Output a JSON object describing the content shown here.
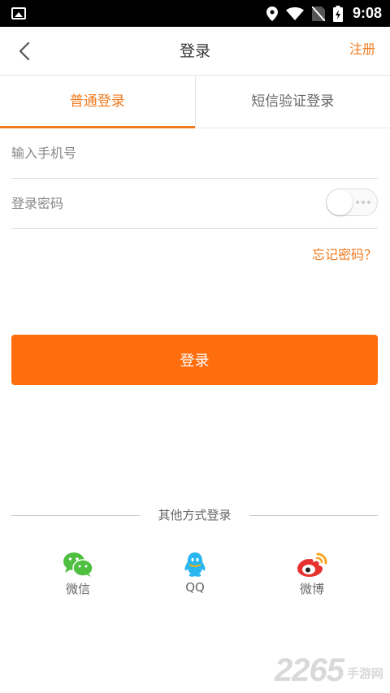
{
  "status_bar": {
    "time": "9:08",
    "icons": [
      "gallery-icon",
      "location-icon",
      "wifi-icon",
      "no-sim-icon",
      "battery-charging-icon"
    ]
  },
  "header": {
    "back_icon": "chevron-left-icon",
    "title": "登录",
    "register_label": "注册"
  },
  "tabs": [
    {
      "label": "普通登录",
      "active": true
    },
    {
      "label": "短信验证登录",
      "active": false
    }
  ],
  "form": {
    "phone": {
      "value": "",
      "placeholder": "输入手机号"
    },
    "password": {
      "value": "",
      "placeholder": "登录密码",
      "show_password": false
    },
    "forgot_label": "忘记密码？",
    "submit_label": "登录"
  },
  "other_login": {
    "divider_text": "其他方式登录",
    "methods": [
      {
        "label": "微信",
        "icon": "wechat-icon",
        "color": "#4fbf40"
      },
      {
        "label": "QQ",
        "icon": "qq-icon",
        "color": "#2ab6f0"
      },
      {
        "label": "微博",
        "icon": "weibo-icon",
        "color": "#e6312e"
      }
    ]
  },
  "watermark": {
    "digits": "2265",
    "site": "手游网"
  },
  "colors": {
    "accent": "#f07a1e",
    "button": "#ff6d0d"
  }
}
